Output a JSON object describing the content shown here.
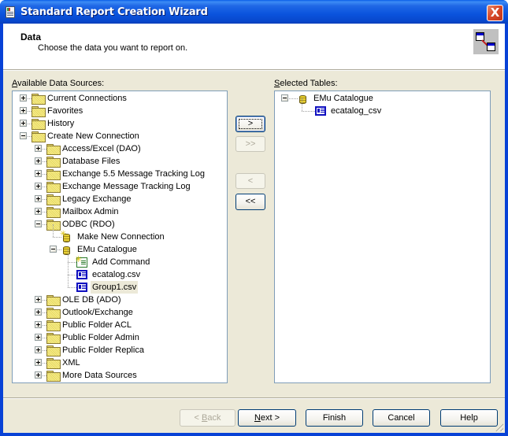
{
  "window": {
    "title": "Standard Report Creation Wizard",
    "close_label": "X"
  },
  "header": {
    "title": "Data",
    "subtitle": "Choose the data you want to report on.",
    "icon": "table-link-icon"
  },
  "available": {
    "label_accel": "A",
    "label_rest": "vailable Data Sources:",
    "items": [
      {
        "label": "Current Connections",
        "icon": "folder-icon",
        "expander": "plus",
        "level": 0
      },
      {
        "label": "Favorites",
        "icon": "folder-icon",
        "expander": "plus",
        "level": 0
      },
      {
        "label": "History",
        "icon": "folder-icon",
        "expander": "plus",
        "level": 0
      },
      {
        "label": "Create New Connection",
        "icon": "folder-icon",
        "expander": "minus",
        "level": 0
      },
      {
        "label": "Access/Excel (DAO)",
        "icon": "folder-icon",
        "expander": "plus",
        "level": 1
      },
      {
        "label": "Database Files",
        "icon": "folder-icon",
        "expander": "plus",
        "level": 1
      },
      {
        "label": "Exchange 5.5 Message Tracking Log",
        "icon": "folder-icon",
        "expander": "plus",
        "level": 1
      },
      {
        "label": "Exchange Message Tracking Log",
        "icon": "folder-icon",
        "expander": "plus",
        "level": 1
      },
      {
        "label": "Legacy Exchange",
        "icon": "folder-icon",
        "expander": "plus",
        "level": 1
      },
      {
        "label": "Mailbox Admin",
        "icon": "folder-icon",
        "expander": "plus",
        "level": 1
      },
      {
        "label": "ODBC (RDO)",
        "icon": "folder-icon",
        "expander": "minus",
        "level": 1
      },
      {
        "label": "Make New Connection",
        "icon": "new-connection-icon",
        "expander": "none",
        "level": 2
      },
      {
        "label": "EMu Catalogue",
        "icon": "database-icon",
        "expander": "minus",
        "level": 2
      },
      {
        "label": "Add Command",
        "icon": "add-command-icon",
        "expander": "none",
        "level": 3
      },
      {
        "label": "ecatalog.csv",
        "icon": "table-icon",
        "expander": "none",
        "level": 3
      },
      {
        "label": "Group1.csv",
        "icon": "table-icon",
        "expander": "none",
        "level": 3,
        "selected": true
      },
      {
        "label": "OLE DB (ADO)",
        "icon": "folder-icon",
        "expander": "plus",
        "level": 1
      },
      {
        "label": "Outlook/Exchange",
        "icon": "folder-icon",
        "expander": "plus",
        "level": 1
      },
      {
        "label": "Public Folder ACL",
        "icon": "folder-icon",
        "expander": "plus",
        "level": 1
      },
      {
        "label": "Public Folder Admin",
        "icon": "folder-icon",
        "expander": "plus",
        "level": 1
      },
      {
        "label": "Public Folder Replica",
        "icon": "folder-icon",
        "expander": "plus",
        "level": 1
      },
      {
        "label": "XML",
        "icon": "folder-icon",
        "expander": "plus",
        "level": 1
      },
      {
        "label": "More Data Sources",
        "icon": "folder-icon",
        "expander": "plus",
        "level": 1
      }
    ]
  },
  "selected": {
    "label_accel": "S",
    "label_rest": "elected Tables:",
    "items": [
      {
        "label": "EMu Catalogue",
        "icon": "database-icon",
        "expander": "minus",
        "level": 0
      },
      {
        "label": "ecatalog_csv",
        "icon": "table-icon",
        "expander": "none",
        "level": 1
      }
    ]
  },
  "transfer": {
    "add_one": ">",
    "add_all": ">>",
    "remove_one": "<",
    "remove_all": "<<"
  },
  "footer": {
    "back_pre": "< ",
    "back_accel": "B",
    "back_rest": "ack",
    "next_accel": "N",
    "next_rest": "ext >",
    "finish": "Finish",
    "cancel": "Cancel",
    "help": "Help"
  }
}
